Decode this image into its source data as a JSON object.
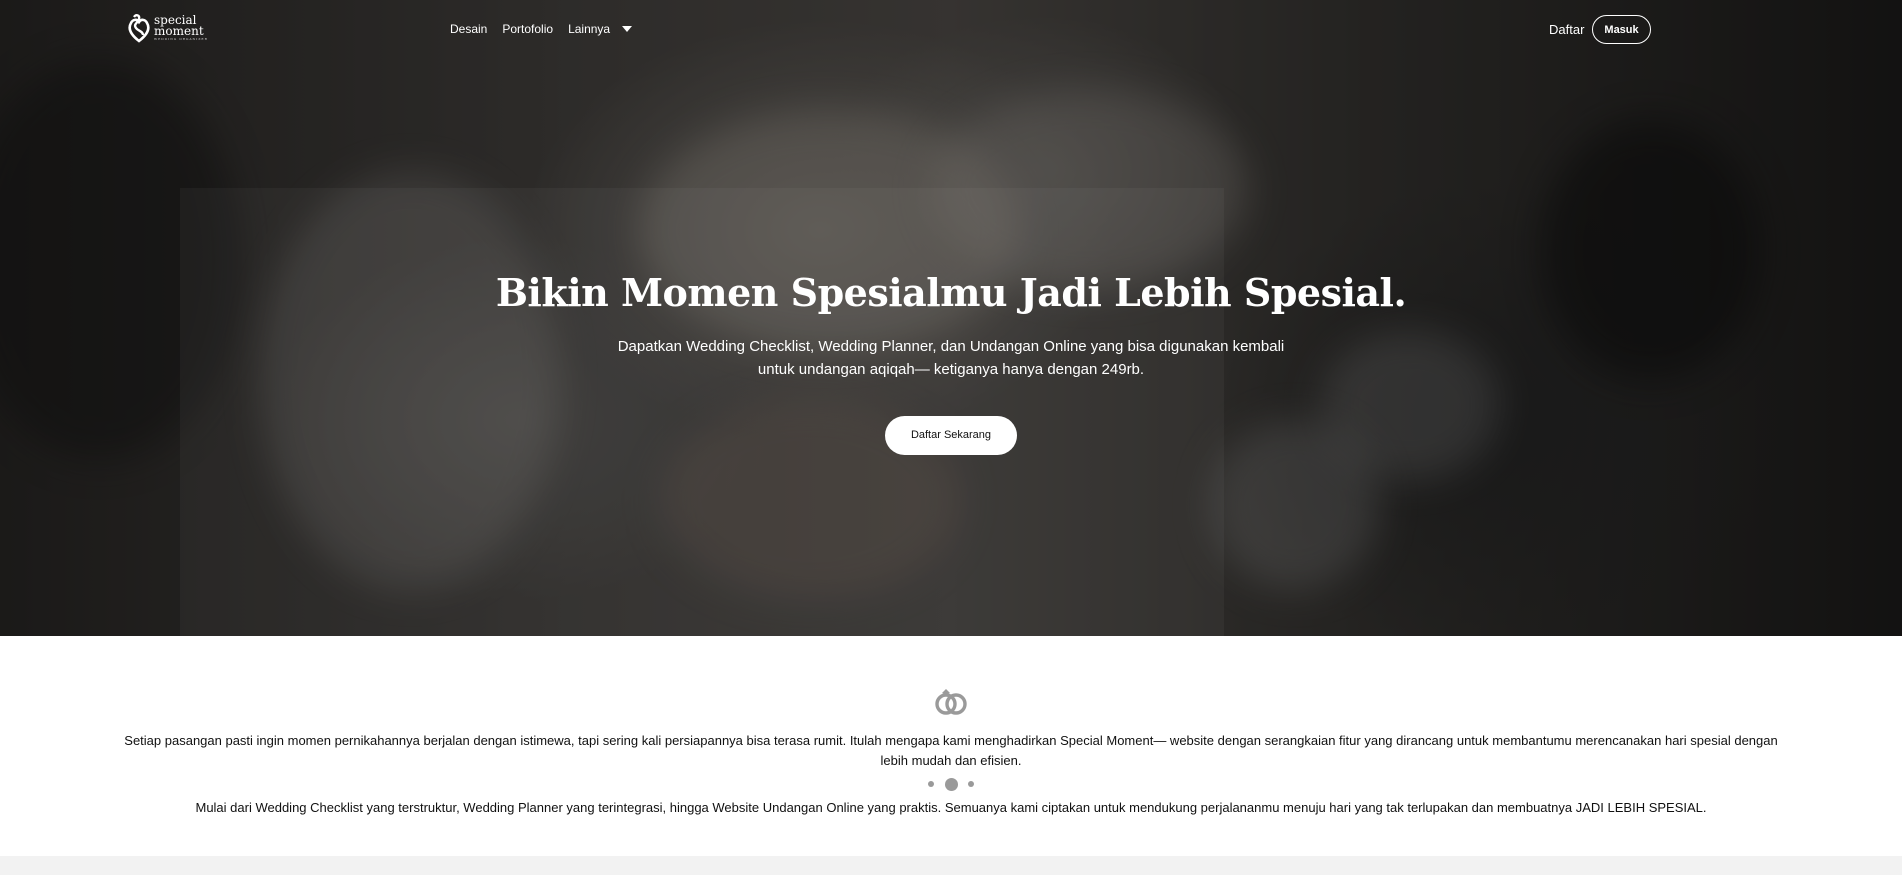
{
  "brand": {
    "name_line1": "special",
    "name_line2": "moment",
    "tagline": "WEDDING ORGANIZER"
  },
  "nav": {
    "items": [
      {
        "label": "Desain"
      },
      {
        "label": "Portofolio"
      },
      {
        "label": "Lainnya"
      }
    ],
    "register_label": "Daftar",
    "login_label": "Masuk"
  },
  "hero": {
    "title": "Bikin Momen Spesialmu Jadi Lebih Spesial.",
    "subtitle": "Dapatkan Wedding Checklist, Wedding Planner, dan Undangan Online yang bisa digunakan kembali untuk undangan aqiqah— ketiganya hanya dengan 249rb.",
    "cta_label": "Daftar Sekarang"
  },
  "intro": {
    "icon": "wedding-rings-icon",
    "paragraph1": "Setiap pasangan pasti ingin momen pernikahannya berjalan dengan istimewa, tapi sering kali persiapannya bisa terasa rumit. Itulah mengapa kami menghadirkan Special Moment— website dengan serangkaian fitur yang dirancang untuk membantumu merencanakan hari spesial dengan lebih mudah dan efisien.",
    "paragraph2": "Mulai dari Wedding Checklist yang terstruktur, Wedding Planner yang terintegrasi, hingga Website Undangan Online yang praktis. Semuanya kami ciptakan untuk mendukung perjalananmu menuju hari yang tak terlupakan dan membuatnya JADI LEBIH SPESIAL."
  },
  "colors": {
    "hero_overlay": "#000000",
    "text_light": "#ffffff",
    "divider_dots": "#9a9a9a"
  }
}
